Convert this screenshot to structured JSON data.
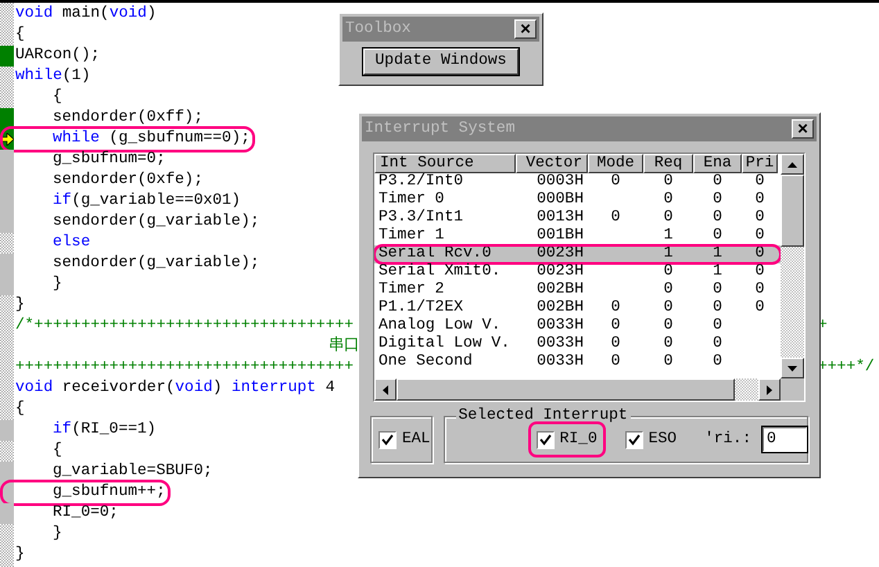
{
  "editor": {
    "lines": [
      {
        "kind": "plain",
        "indented": false,
        "current": false,
        "highlighted": false,
        "segments": [
          {
            "kind": "keyword",
            "text": "void"
          },
          {
            "kind": "plain",
            "text": " main("
          },
          {
            "kind": "keyword",
            "text": "void"
          },
          {
            "kind": "plain",
            "text": ")"
          }
        ]
      },
      {
        "kind": "plain",
        "indented": false,
        "current": false,
        "highlighted": false,
        "segments": [
          {
            "kind": "plain",
            "text": "{"
          }
        ]
      },
      {
        "kind": "executed",
        "indented": false,
        "current": false,
        "highlighted": false,
        "segments": [
          {
            "kind": "plain",
            "text": "UARcon();"
          }
        ]
      },
      {
        "kind": "plain",
        "indented": false,
        "current": false,
        "highlighted": false,
        "segments": [
          {
            "kind": "keyword",
            "text": "while"
          },
          {
            "kind": "plain",
            "text": "(1)"
          }
        ]
      },
      {
        "kind": "plain",
        "indented": true,
        "current": false,
        "highlighted": false,
        "segments": [
          {
            "kind": "plain",
            "text": "{"
          }
        ]
      },
      {
        "kind": "executed",
        "indented": true,
        "current": false,
        "highlighted": false,
        "segments": [
          {
            "kind": "plain",
            "text": "sendorder(0xff);"
          }
        ]
      },
      {
        "kind": "executed",
        "indented": true,
        "current": true,
        "highlighted": true,
        "segments": [
          {
            "kind": "keyword",
            "text": "while"
          },
          {
            "kind": "plain",
            "text": " (g_sbufnum==0);"
          }
        ]
      },
      {
        "kind": "code",
        "indented": true,
        "current": false,
        "highlighted": false,
        "segments": [
          {
            "kind": "plain",
            "text": "g_sbufnum=0;"
          }
        ]
      },
      {
        "kind": "code",
        "indented": true,
        "current": false,
        "highlighted": false,
        "segments": [
          {
            "kind": "plain",
            "text": "sendorder(0xfe);"
          }
        ]
      },
      {
        "kind": "code",
        "indented": true,
        "current": false,
        "highlighted": false,
        "segments": [
          {
            "kind": "keyword",
            "text": "if"
          },
          {
            "kind": "plain",
            "text": "(g_variable==0x01)"
          }
        ]
      },
      {
        "kind": "code",
        "indented": true,
        "current": false,
        "highlighted": false,
        "segments": [
          {
            "kind": "plain",
            "text": "sendorder(g_variable);"
          }
        ]
      },
      {
        "kind": "plain",
        "indented": true,
        "current": false,
        "highlighted": false,
        "segments": [
          {
            "kind": "keyword",
            "text": "else"
          }
        ]
      },
      {
        "kind": "code",
        "indented": true,
        "current": false,
        "highlighted": false,
        "segments": [
          {
            "kind": "plain",
            "text": "sendorder(g_variable);"
          }
        ]
      },
      {
        "kind": "code",
        "indented": true,
        "current": false,
        "highlighted": false,
        "segments": [
          {
            "kind": "plain",
            "text": "}"
          }
        ]
      },
      {
        "kind": "plain",
        "indented": false,
        "current": false,
        "highlighted": false,
        "segments": [
          {
            "kind": "plain",
            "text": "}"
          }
        ]
      },
      {
        "kind": "plain",
        "indented": false,
        "current": false,
        "highlighted": false,
        "segments": [
          {
            "kind": "comment",
            "text": "/*++++++++++++++++++++++++++++++++++"
          }
        ],
        "right": "+"
      },
      {
        "kind": "plain",
        "indented": false,
        "current": false,
        "highlighted": false,
        "segments": [
          {
            "kind": "banner",
            "text": "串口"
          }
        ]
      },
      {
        "kind": "plain",
        "indented": false,
        "current": false,
        "highlighted": false,
        "segments": [
          {
            "kind": "comment",
            "text": "++++++++++++++++++++++++++++++++++++"
          }
        ],
        "right": "++++*/"
      },
      {
        "kind": "plain",
        "indented": false,
        "current": false,
        "highlighted": false,
        "segments": [
          {
            "kind": "keyword",
            "text": "void"
          },
          {
            "kind": "plain",
            "text": " receivorder("
          },
          {
            "kind": "keyword",
            "text": "void"
          },
          {
            "kind": "plain",
            "text": ") "
          },
          {
            "kind": "keyword",
            "text": "interrupt"
          },
          {
            "kind": "plain",
            "text": " 4"
          }
        ]
      },
      {
        "kind": "plain",
        "indented": false,
        "current": false,
        "highlighted": false,
        "segments": [
          {
            "kind": "plain",
            "text": "{"
          }
        ]
      },
      {
        "kind": "code",
        "indented": true,
        "current": false,
        "highlighted": false,
        "segments": [
          {
            "kind": "keyword",
            "text": "if"
          },
          {
            "kind": "plain",
            "text": "(RI_0==1)"
          }
        ]
      },
      {
        "kind": "plain",
        "indented": true,
        "current": false,
        "highlighted": false,
        "segments": [
          {
            "kind": "plain",
            "text": "{"
          }
        ]
      },
      {
        "kind": "code",
        "indented": true,
        "current": false,
        "highlighted": false,
        "segments": [
          {
            "kind": "plain",
            "text": "g_variable=SBUF0;"
          }
        ]
      },
      {
        "kind": "code",
        "indented": true,
        "current": false,
        "highlighted": true,
        "segments": [
          {
            "kind": "plain",
            "text": "g_sbufnum++;"
          }
        ]
      },
      {
        "kind": "code",
        "indented": true,
        "current": false,
        "highlighted": false,
        "segments": [
          {
            "kind": "plain",
            "text": "RI_0=0;"
          }
        ]
      },
      {
        "kind": "plain",
        "indented": true,
        "current": false,
        "highlighted": false,
        "segments": [
          {
            "kind": "plain",
            "text": "}"
          }
        ]
      },
      {
        "kind": "plain",
        "indented": false,
        "current": false,
        "highlighted": false,
        "segments": [
          {
            "kind": "plain",
            "text": "}"
          }
        ]
      }
    ]
  },
  "toolbox": {
    "title": "Toolbox",
    "close": "×",
    "button": "Update Windows"
  },
  "interrupt_system": {
    "title": "Interrupt System",
    "close": "×",
    "columns": [
      "Int Source",
      "Vector",
      "Mode",
      "Req",
      "Ena",
      "Pri"
    ],
    "rows": [
      {
        "source": "P3.2/Int0",
        "vector": "0003H",
        "mode": "0",
        "req": "0",
        "ena": "0",
        "pri": "0",
        "selected": false,
        "highlighted": false
      },
      {
        "source": "Timer 0",
        "vector": "000BH",
        "req": "0",
        "ena": "0",
        "pri": "0",
        "selected": false,
        "highlighted": false
      },
      {
        "source": "P3.3/Int1",
        "vector": "0013H",
        "mode": "0",
        "req": "0",
        "ena": "0",
        "pri": "0",
        "selected": false,
        "highlighted": false
      },
      {
        "source": "Timer 1",
        "vector": "001BH",
        "req": "1",
        "ena": "0",
        "pri": "0",
        "selected": false,
        "highlighted": false
      },
      {
        "source": "Serial Rcv.0",
        "vector": "0023H",
        "req": "1",
        "ena": "1",
        "pri": "0",
        "selected": true,
        "highlighted": true
      },
      {
        "source": "Serial Xmit0.",
        "vector": "0023H",
        "req": "0",
        "ena": "1",
        "pri": "0",
        "selected": false,
        "highlighted": false
      },
      {
        "source": "Timer 2",
        "vector": "002BH",
        "req": "0",
        "ena": "0",
        "pri": "0",
        "selected": false,
        "highlighted": false
      },
      {
        "source": "P1.1/T2EX",
        "vector": "002BH",
        "mode": "0",
        "req": "0",
        "ena": "0",
        "pri": "0",
        "selected": false,
        "highlighted": false
      },
      {
        "source": "Analog Low V.",
        "vector": "0033H",
        "mode": "0",
        "req": "0",
        "ena": "0",
        "selected": false,
        "highlighted": false
      },
      {
        "source": "Digital Low V.",
        "vector": "0033H",
        "mode": "0",
        "req": "0",
        "ena": "0",
        "selected": false,
        "highlighted": false
      },
      {
        "source": "One Second",
        "vector": "0033H",
        "mode": "0",
        "req": "0",
        "ena": "0",
        "selected": false,
        "highlighted": false
      }
    ],
    "eal": {
      "label": "EAL",
      "checked": true
    },
    "selected_interrupt": {
      "title": "Selected Interrupt",
      "flags": [
        {
          "label": "RI_0",
          "checked": true,
          "highlighted": true
        },
        {
          "label": "ESO",
          "checked": true,
          "highlighted": false
        }
      ],
      "field": {
        "label": "'ri.:",
        "value": "0"
      }
    }
  }
}
